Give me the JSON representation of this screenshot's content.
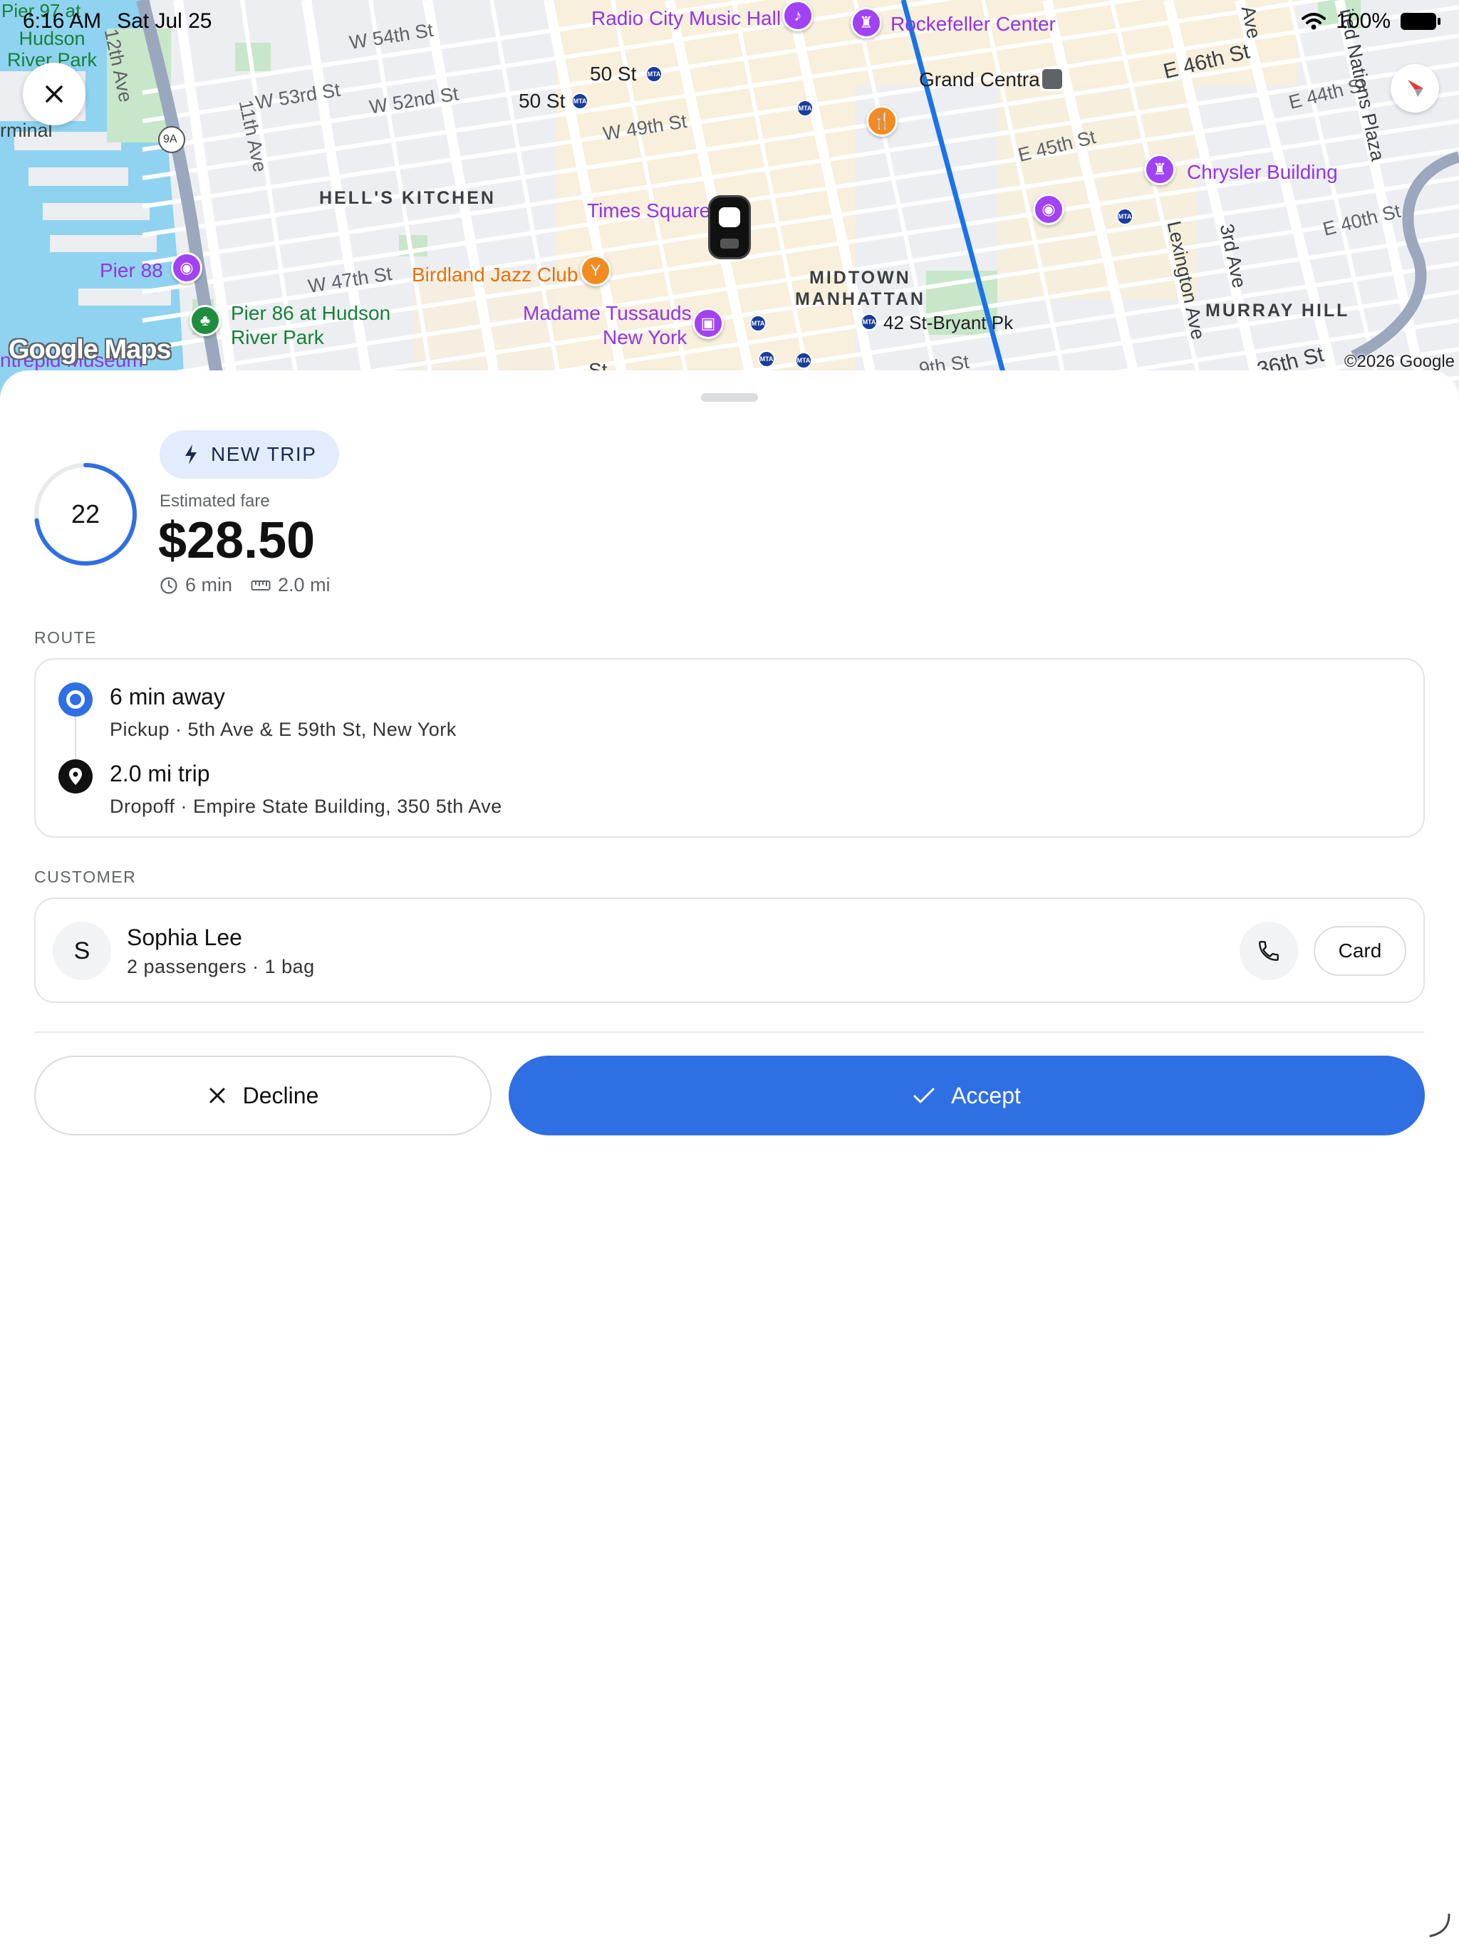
{
  "status_bar": {
    "time": "6:16 AM",
    "date": "Sat Jul 25",
    "battery": "100%"
  },
  "map": {
    "logo": "Google Maps",
    "copyright": "©2026 Google",
    "labels": {
      "hudson_river_park": "Hudson\nRiver Park",
      "pier_97": "Pier 97 at",
      "terminal": "rminal",
      "hells_kitchen": "HELL'S KITCHEN",
      "midtown": "MIDTOWN",
      "manhattan": "MANHATTAN",
      "murray_hill": "MURRAY HILL",
      "times_square": "Times Square",
      "radio_city": "Radio City Music Hall",
      "rockefeller": "Rockefeller Center",
      "grand_central": "Grand Central",
      "chrysler": "Chrysler Building",
      "birdland": "Birdland Jazz Club",
      "tussauds_1": "Madame Tussauds",
      "tussauds_2": "New York",
      "pier_88": "Pier 88",
      "pier_86_1": "Pier 86 at Hudson",
      "pier_86_2": "River Park",
      "intrepid": "ntrepid Museum",
      "station_bryant": "42 St-Bryant Pk",
      "st_50_a": "50 St",
      "st_50_b": "50 St",
      "w54": "W 54th St",
      "w53": "W 53rd St",
      "w52": "W 52nd St",
      "w49": "W 49th St",
      "w47": "W 47th St",
      "e46": "E 46th St",
      "e45": "E 45th St",
      "e44": "E 44th St",
      "e40": "E 40th St",
      "e36": "E 36th St",
      "ave11": "11th Ave",
      "ave12": "12th Ave",
      "lexington": "Lexington Ave",
      "ave3": "3rd Ave",
      "un_plaza": "ited Nations Plaza",
      "ave_top": "Ave",
      "route_9a": "9A",
      "st_bottom": "St",
      "th_st_bottom": "9th St",
      "st_bottom_right": "36th St"
    }
  },
  "trip": {
    "countdown": "22",
    "countdown_fraction": 0.73,
    "badge": "NEW TRIP",
    "fare_label": "Estimated fare",
    "fare_value": "$28.50",
    "duration": "6 min",
    "distance": "2.0 mi"
  },
  "route": {
    "section_label": "ROUTE",
    "pickup": {
      "title": "6 min away",
      "detail": "Pickup · 5th Ave & E 59th St, New York"
    },
    "dropoff": {
      "title": "2.0 mi trip",
      "detail": "Dropoff · Empire State Building, 350 5th Ave"
    }
  },
  "customer": {
    "section_label": "CUSTOMER",
    "initial": "S",
    "name": "Sophia Lee",
    "details": "2 passengers · 1 bag",
    "card_label": "Card"
  },
  "actions": {
    "decline": "Decline",
    "accept": "Accept"
  },
  "colors": {
    "accent": "#2f6fe4",
    "badge_bg": "#e3ecfc",
    "poi": "#9334e6",
    "route_line": "#1a73e8"
  }
}
